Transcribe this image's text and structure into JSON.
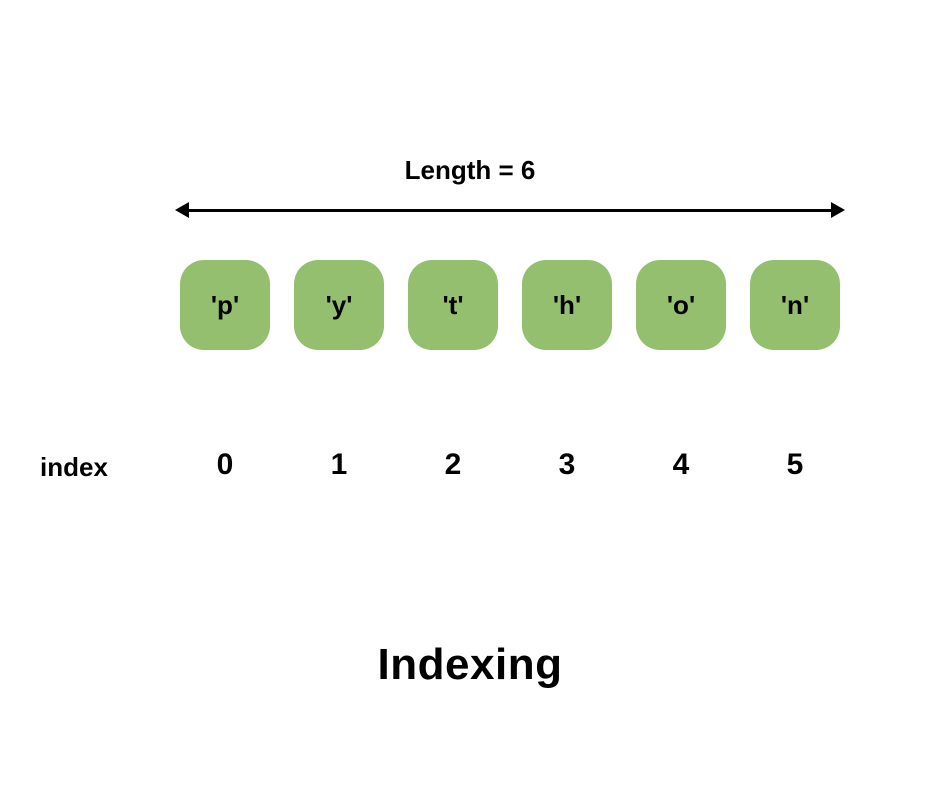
{
  "length_label": "Length = 6",
  "index_label": "index",
  "title": "Indexing",
  "cells": [
    "'p'",
    "'y'",
    "'t'",
    "'h'",
    "'o'",
    "'n'"
  ],
  "indices": [
    "0",
    "1",
    "2",
    "3",
    "4",
    "5"
  ]
}
